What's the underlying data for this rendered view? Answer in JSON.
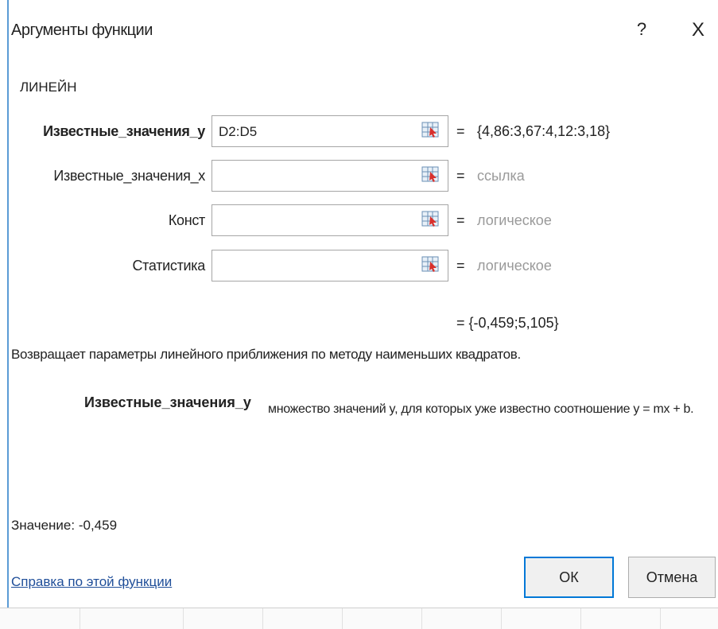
{
  "dialog": {
    "title": "Аргументы функции",
    "help_symbol": "?",
    "close_symbol": "X",
    "function_name": "ЛИНЕЙН"
  },
  "arguments": [
    {
      "label": "Известные_значения_y",
      "bold": true,
      "value": "D2:D5",
      "equals": "=",
      "result": "{4,86:3,67:4,12:3,18}",
      "result_muted": false
    },
    {
      "label": "Известные_значения_x",
      "bold": false,
      "value": "",
      "equals": "=",
      "result": "ссылка",
      "result_muted": true
    },
    {
      "label": "Конст",
      "bold": false,
      "value": "",
      "equals": "=",
      "result": "логическое",
      "result_muted": true
    },
    {
      "label": "Статистика",
      "bold": false,
      "value": "",
      "equals": "=",
      "result": "логическое",
      "result_muted": true
    }
  ],
  "overall_result": "=  {-0,459;5,105}",
  "description": "Возвращает параметры линейного приближения по методу наименьших квадратов.",
  "argument_help": {
    "name": "Известные_значения_y",
    "text": "множество значений y, для которых уже известно соотношение y = mx + b."
  },
  "value_line": "Значение:   -0,459",
  "help_link": "Справка по этой функции",
  "buttons": {
    "ok": "ОК",
    "cancel": "Отмена"
  },
  "icons": {
    "ref_button": "range-select-icon"
  },
  "colors": {
    "accent": "#0078d7",
    "link": "#1f4e99",
    "muted_text": "#9a9a9a"
  }
}
